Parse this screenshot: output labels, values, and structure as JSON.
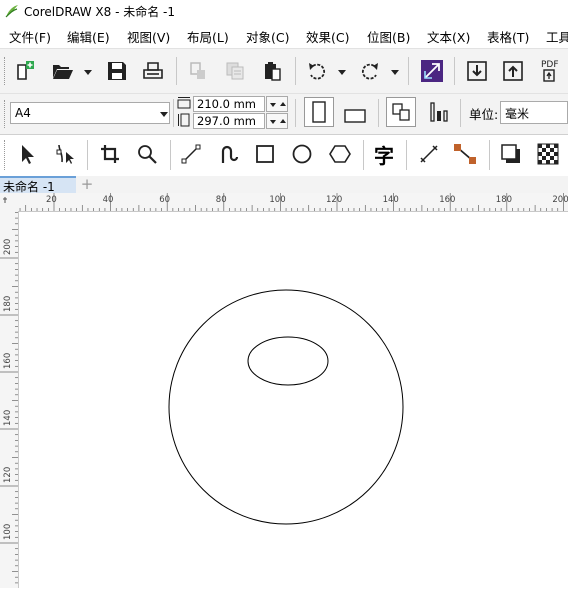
{
  "app": {
    "title": "CorelDRAW X8 - 未命名 -1"
  },
  "menu": [
    {
      "label": "文件(F)"
    },
    {
      "label": "编辑(E)"
    },
    {
      "label": "视图(V)"
    },
    {
      "label": "布局(L)"
    },
    {
      "label": "对象(C)"
    },
    {
      "label": "效果(C)"
    },
    {
      "label": "位图(B)"
    },
    {
      "label": "文本(X)"
    },
    {
      "label": "表格(T)"
    },
    {
      "label": "工具"
    }
  ],
  "standard_toolbar": {
    "icons": [
      "new-document-icon",
      "open-folder-icon",
      "save-icon",
      "print-icon",
      "cut-icon",
      "copy-icon",
      "paste-icon",
      "undo-icon",
      "redo-icon",
      "import-icon",
      "export-icon",
      "publish-pdf-icon",
      "launcher-icon"
    ],
    "pdf_label": "PDF"
  },
  "property_bar": {
    "page_size": "A4",
    "width": "210.0 mm",
    "height": "297.0 mm",
    "unit_label": "单位:",
    "unit_value": "毫米"
  },
  "toolbox": {
    "icons": [
      "pick-tool-icon",
      "shape-tool-icon",
      "crop-tool-icon",
      "zoom-tool-icon",
      "freehand-tool-icon",
      "artistic-media-icon",
      "rectangle-tool-icon",
      "ellipse-tool-icon",
      "polygon-tool-icon",
      "text-tool-icon",
      "dimension-tool-icon",
      "connector-tool-icon",
      "drop-shadow-icon",
      "transparency-icon"
    ],
    "text_tool_glyph": "字"
  },
  "document_tab": {
    "label": "未命名 -1",
    "add_symbol": "+"
  },
  "ruler_h": {
    "labels": [
      "20",
      "40",
      "60",
      "80",
      "100",
      "120",
      "140",
      "160",
      "180",
      "200"
    ]
  },
  "ruler_v": {
    "labels": [
      "200",
      "180",
      "160",
      "140",
      "120",
      "100"
    ]
  },
  "colors": {
    "toolbar_bg": "#f3f3f3",
    "tab_active": "#d6e4f4",
    "accent": "#6aa0d8",
    "pdf_logo": "#5a2d82"
  }
}
